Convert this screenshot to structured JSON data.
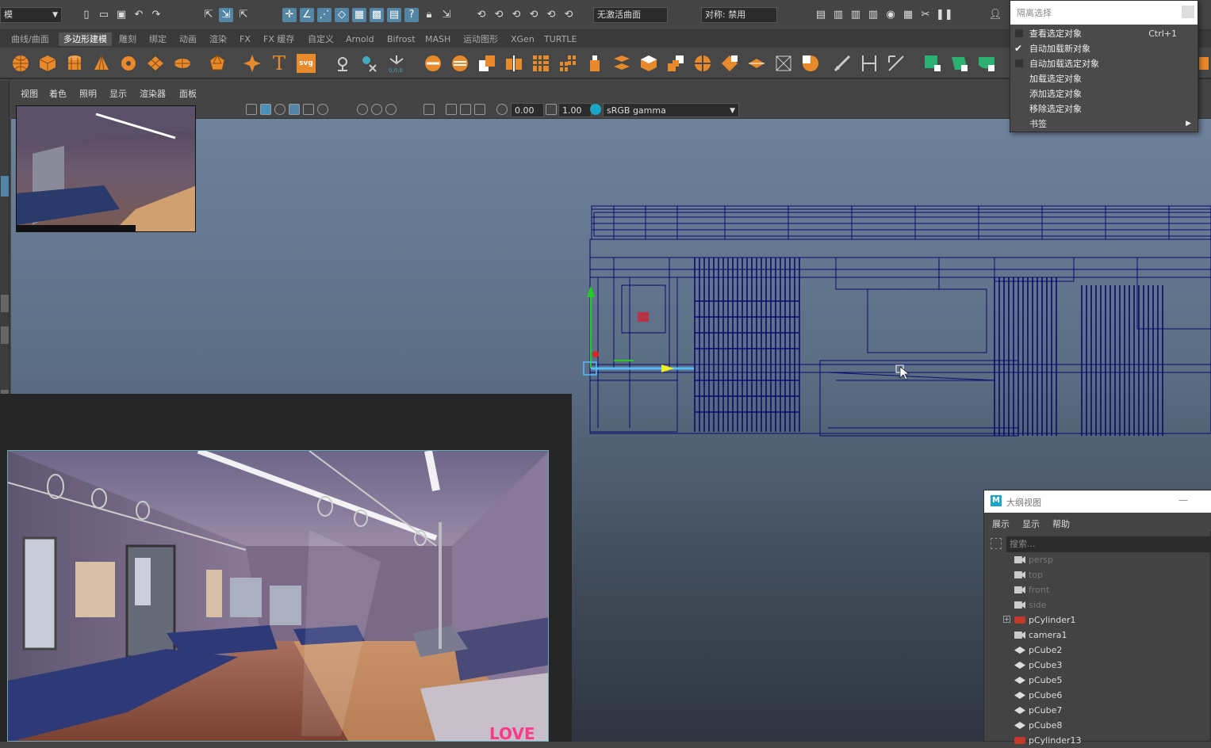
{
  "statusbar": {
    "mode_value": "模",
    "surface_field": "无激活曲面",
    "symmetry_field": "对称: 禁用"
  },
  "shelf_tabs": [
    "曲线/曲面",
    "多边形建模",
    "雕刻",
    "绑定",
    "动画",
    "渲染",
    "FX",
    "FX 缓存",
    "自定义",
    "Arnold",
    "Bifrost",
    "MASH",
    "运动图形",
    "XGen",
    "TURTLE"
  ],
  "shelf_active": "多边形建模",
  "shelf_text": {
    "type_icon": "T",
    "svg_icon": "svg"
  },
  "viewport_menu": [
    "视图",
    "着色",
    "照明",
    "显示",
    "渲染器",
    "面板"
  ],
  "viewport_toolbar": {
    "exposure": "0.00",
    "gamma": "1.00",
    "colorspace": "sRGB gamma"
  },
  "isolate_menu": {
    "header": "隔离选择",
    "items": [
      {
        "label": "查看选定对象",
        "shortcut": "Ctrl+1",
        "checked": false,
        "checkbox": true
      },
      {
        "label": "自动加载新对象",
        "shortcut": "",
        "checked": true,
        "checkbox": true
      },
      {
        "label": "自动加载选定对象",
        "shortcut": "",
        "checked": false,
        "checkbox": true
      },
      {
        "label": "加载选定对象",
        "shortcut": "",
        "checked": false,
        "checkbox": false
      },
      {
        "label": "添加选定对象",
        "shortcut": "",
        "checked": false,
        "checkbox": false
      },
      {
        "label": "移除选定对象",
        "shortcut": "",
        "checked": false,
        "checkbox": false
      },
      {
        "label": "书签",
        "shortcut": "",
        "checked": false,
        "checkbox": false,
        "submenu": true
      }
    ]
  },
  "outliner": {
    "logo": "M",
    "title": "大纲视图",
    "minimize": "—",
    "menu": [
      "展示",
      "显示",
      "帮助"
    ],
    "search_placeholder": "搜索...",
    "items": [
      {
        "name": "persp",
        "icon": "camera-icon",
        "dim": true
      },
      {
        "name": "top",
        "icon": "camera-icon",
        "dim": true
      },
      {
        "name": "front",
        "icon": "camera-icon",
        "dim": true
      },
      {
        "name": "side",
        "icon": "camera-icon",
        "dim": true
      },
      {
        "name": "pCylinder1",
        "icon": "cylinder-icon",
        "dim": false,
        "expandable": true
      },
      {
        "name": "camera1",
        "icon": "camera-icon",
        "dim": false
      },
      {
        "name": "pCube2",
        "icon": "mesh-icon",
        "dim": false
      },
      {
        "name": "pCube3",
        "icon": "mesh-icon",
        "dim": false
      },
      {
        "name": "pCube5",
        "icon": "mesh-icon",
        "dim": false
      },
      {
        "name": "pCube6",
        "icon": "mesh-icon",
        "dim": false
      },
      {
        "name": "pCube7",
        "icon": "mesh-icon",
        "dim": false
      },
      {
        "name": "pCube8",
        "icon": "mesh-icon",
        "dim": false
      },
      {
        "name": "pCylinder13",
        "icon": "cylinder-icon",
        "dim": false
      }
    ]
  },
  "reference_image": {
    "logo_text": "LOVE"
  },
  "colors": {
    "wireframe": "#0a0a6e",
    "accent": "#5285a6",
    "viewport_top": "#6e829b",
    "viewport_bottom": "#2e3540"
  }
}
